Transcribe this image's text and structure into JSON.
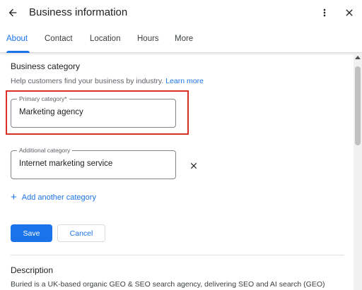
{
  "header": {
    "title": "Business information",
    "back_icon": "arrow-back-icon",
    "more_icon": "more-vert-icon",
    "close_icon": "close-icon"
  },
  "tabs": [
    {
      "label": "About",
      "active": true
    },
    {
      "label": "Contact",
      "active": false
    },
    {
      "label": "Location",
      "active": false
    },
    {
      "label": "Hours",
      "active": false
    },
    {
      "label": "More",
      "active": false
    }
  ],
  "business_category": {
    "title": "Business category",
    "help_text": "Help customers find your business by industry.",
    "learn_more": "Learn more",
    "primary": {
      "label": "Primary category*",
      "value": "Marketing agency"
    },
    "additional": {
      "label": "Additional category",
      "value": "Internet marketing service"
    },
    "add_another": "Add another category",
    "save_label": "Save",
    "cancel_label": "Cancel"
  },
  "description": {
    "title": "Description",
    "text": "Buried is a UK-based organic GEO & SEO search agency, delivering SEO and AI search (GEO)"
  },
  "colors": {
    "accent": "#1a73e8",
    "highlight": "#d93025"
  }
}
